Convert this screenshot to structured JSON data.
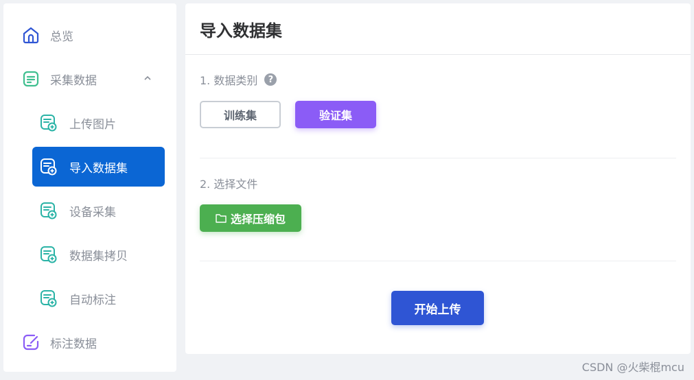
{
  "sidebar": {
    "items": [
      {
        "label": "总览"
      },
      {
        "label": "采集数据"
      },
      {
        "label": "上传图片"
      },
      {
        "label": "导入数据集"
      },
      {
        "label": "设备采集"
      },
      {
        "label": "数据集拷贝"
      },
      {
        "label": "自动标注"
      },
      {
        "label": "标注数据"
      }
    ]
  },
  "main": {
    "title": "导入数据集",
    "section1_label": "1. 数据类别",
    "help_glyph": "?",
    "train_label": "训练集",
    "val_label": "验证集",
    "section2_label": "2. 选择文件",
    "file_button_label": "选择压缩包",
    "upload_button_label": "开始上传"
  },
  "watermark": "CSDN @火柴棍mcu",
  "colors": {
    "active_nav": "#0b66d4",
    "validation": "#8b5cf6",
    "file_button": "#4caf50",
    "upload_button": "#2f55d4"
  }
}
